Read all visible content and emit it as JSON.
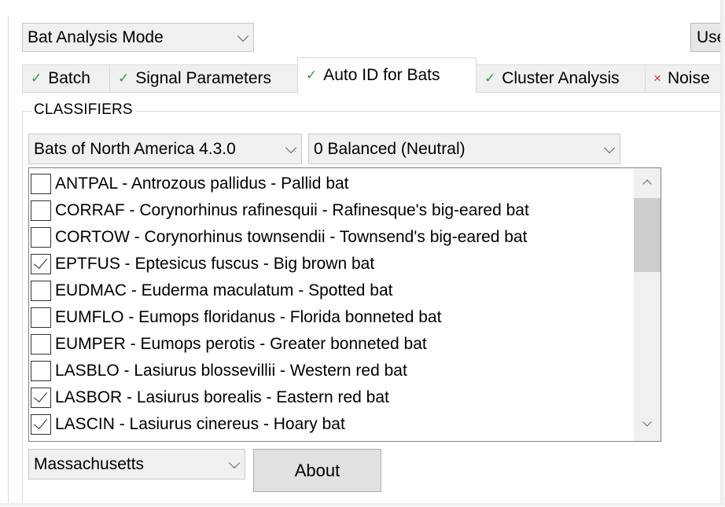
{
  "mode_select": {
    "value": "Bat Analysis Mode"
  },
  "user_button": {
    "label": "Use"
  },
  "tabs": [
    {
      "label": "Batch",
      "status": "✓"
    },
    {
      "label": "Signal Parameters",
      "status": "✓"
    },
    {
      "label": "Auto ID for Bats",
      "status": "✓"
    },
    {
      "label": "Cluster Analysis",
      "status": "✓"
    },
    {
      "label": "Noise",
      "status": "×"
    }
  ],
  "classifiers": {
    "title": "CLASSIFIERS",
    "classifier_select": "Bats of North America 4.3.0",
    "balance_select": "0 Balanced (Neutral)",
    "species": [
      {
        "label": "ANTPAL - Antrozous pallidus - Pallid bat",
        "checked": false
      },
      {
        "label": "CORRAF - Corynorhinus rafinesquii - Rafinesque's big-eared bat",
        "checked": false
      },
      {
        "label": "CORTOW - Corynorhinus townsendii - Townsend's big-eared bat",
        "checked": false
      },
      {
        "label": "EPTFUS - Eptesicus fuscus - Big brown bat",
        "checked": true
      },
      {
        "label": "EUDMAC - Euderma maculatum - Spotted bat",
        "checked": false
      },
      {
        "label": "EUMFLO - Eumops floridanus - Florida bonneted bat",
        "checked": false
      },
      {
        "label": "EUMPER - Eumops perotis - Greater bonneted bat",
        "checked": false
      },
      {
        "label": "LASBLO - Lasiurus blossevillii - Western red bat",
        "checked": false
      },
      {
        "label": "LASBOR - Lasiurus borealis - Eastern red bat",
        "checked": true
      },
      {
        "label": "LASCIN - Lasiurus cinereus - Hoary bat",
        "checked": true
      }
    ],
    "region_select": "Massachusetts",
    "about_label": "About"
  },
  "colors": {
    "ok": "#2e9e3e",
    "bad": "#e0303e"
  }
}
